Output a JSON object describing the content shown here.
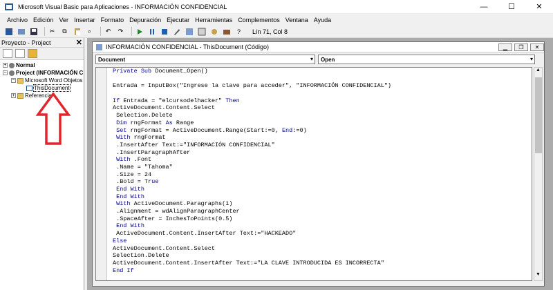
{
  "window": {
    "title": "Microsoft Visual Basic para Aplicaciones - INFORMACIÓN CONFIDENCIAL",
    "min": "—",
    "max": "☐",
    "close": "✕"
  },
  "menu": [
    "Archivo",
    "Edición",
    "Ver",
    "Insertar",
    "Formato",
    "Depuración",
    "Ejecutar",
    "Herramientas",
    "Complementos",
    "Ventana",
    "Ayuda"
  ],
  "toolbar": {
    "position": "Lín 71, Col 8"
  },
  "project_pane": {
    "title": "Proyecto - Project",
    "close": "✕",
    "tree": [
      {
        "label": "Normal",
        "bold": true
      },
      {
        "label": "Project (INFORMACIÓN C",
        "bold": true
      },
      {
        "label": "Microsoft Word Objetos"
      },
      {
        "label": "ThisDocument"
      },
      {
        "label": "Referencias"
      }
    ]
  },
  "code_window": {
    "title": "INFORMACIÓN CONFIDENCIAL - ThisDocument (Código)",
    "object_combo": "Document",
    "proc_combo": "Open",
    "lines": [
      "Private Sub Document_Open()",
      "",
      "Entrada = InputBox(\"Ingrese la clave para acceder\", \"INFORMACIÓN CONFIDENCIAL\")",
      "",
      "If Entrada = \"elcursodelhacker\" Then",
      "ActiveDocument.Content.Select",
      " Selection.Delete",
      " Dim rngFormat As Range",
      " Set rngFormat = ActiveDocument.Range(Start:=0, End:=0)",
      " With rngFormat",
      " .InsertAfter Text:=\"INFORMACIÓN CONFIDENCIAL\"",
      " .InsertParagraphAfter",
      " With .Font",
      " .Name = \"Tahoma\"",
      " .Size = 24",
      " .Bold = True",
      " End With",
      " End With",
      " With ActiveDocument.Paragraphs(1)",
      " .Alignment = wdAlignParagraphCenter",
      " .SpaceAfter = InchesToPoints(0.5)",
      " End With",
      " ActiveDocument.Content.InsertAfter Text:=\"HACKEADO\"",
      "Else",
      "ActiveDocument.Content.Select",
      "Selection.Delete",
      "ActiveDocument.Content.InsertAfter Text:=\"LA CLAVE INTRODUCIDA ES INCORRECTA\"",
      "End If"
    ]
  },
  "colors": {
    "keyword": "#00008b",
    "arrow": "#e0262c"
  }
}
